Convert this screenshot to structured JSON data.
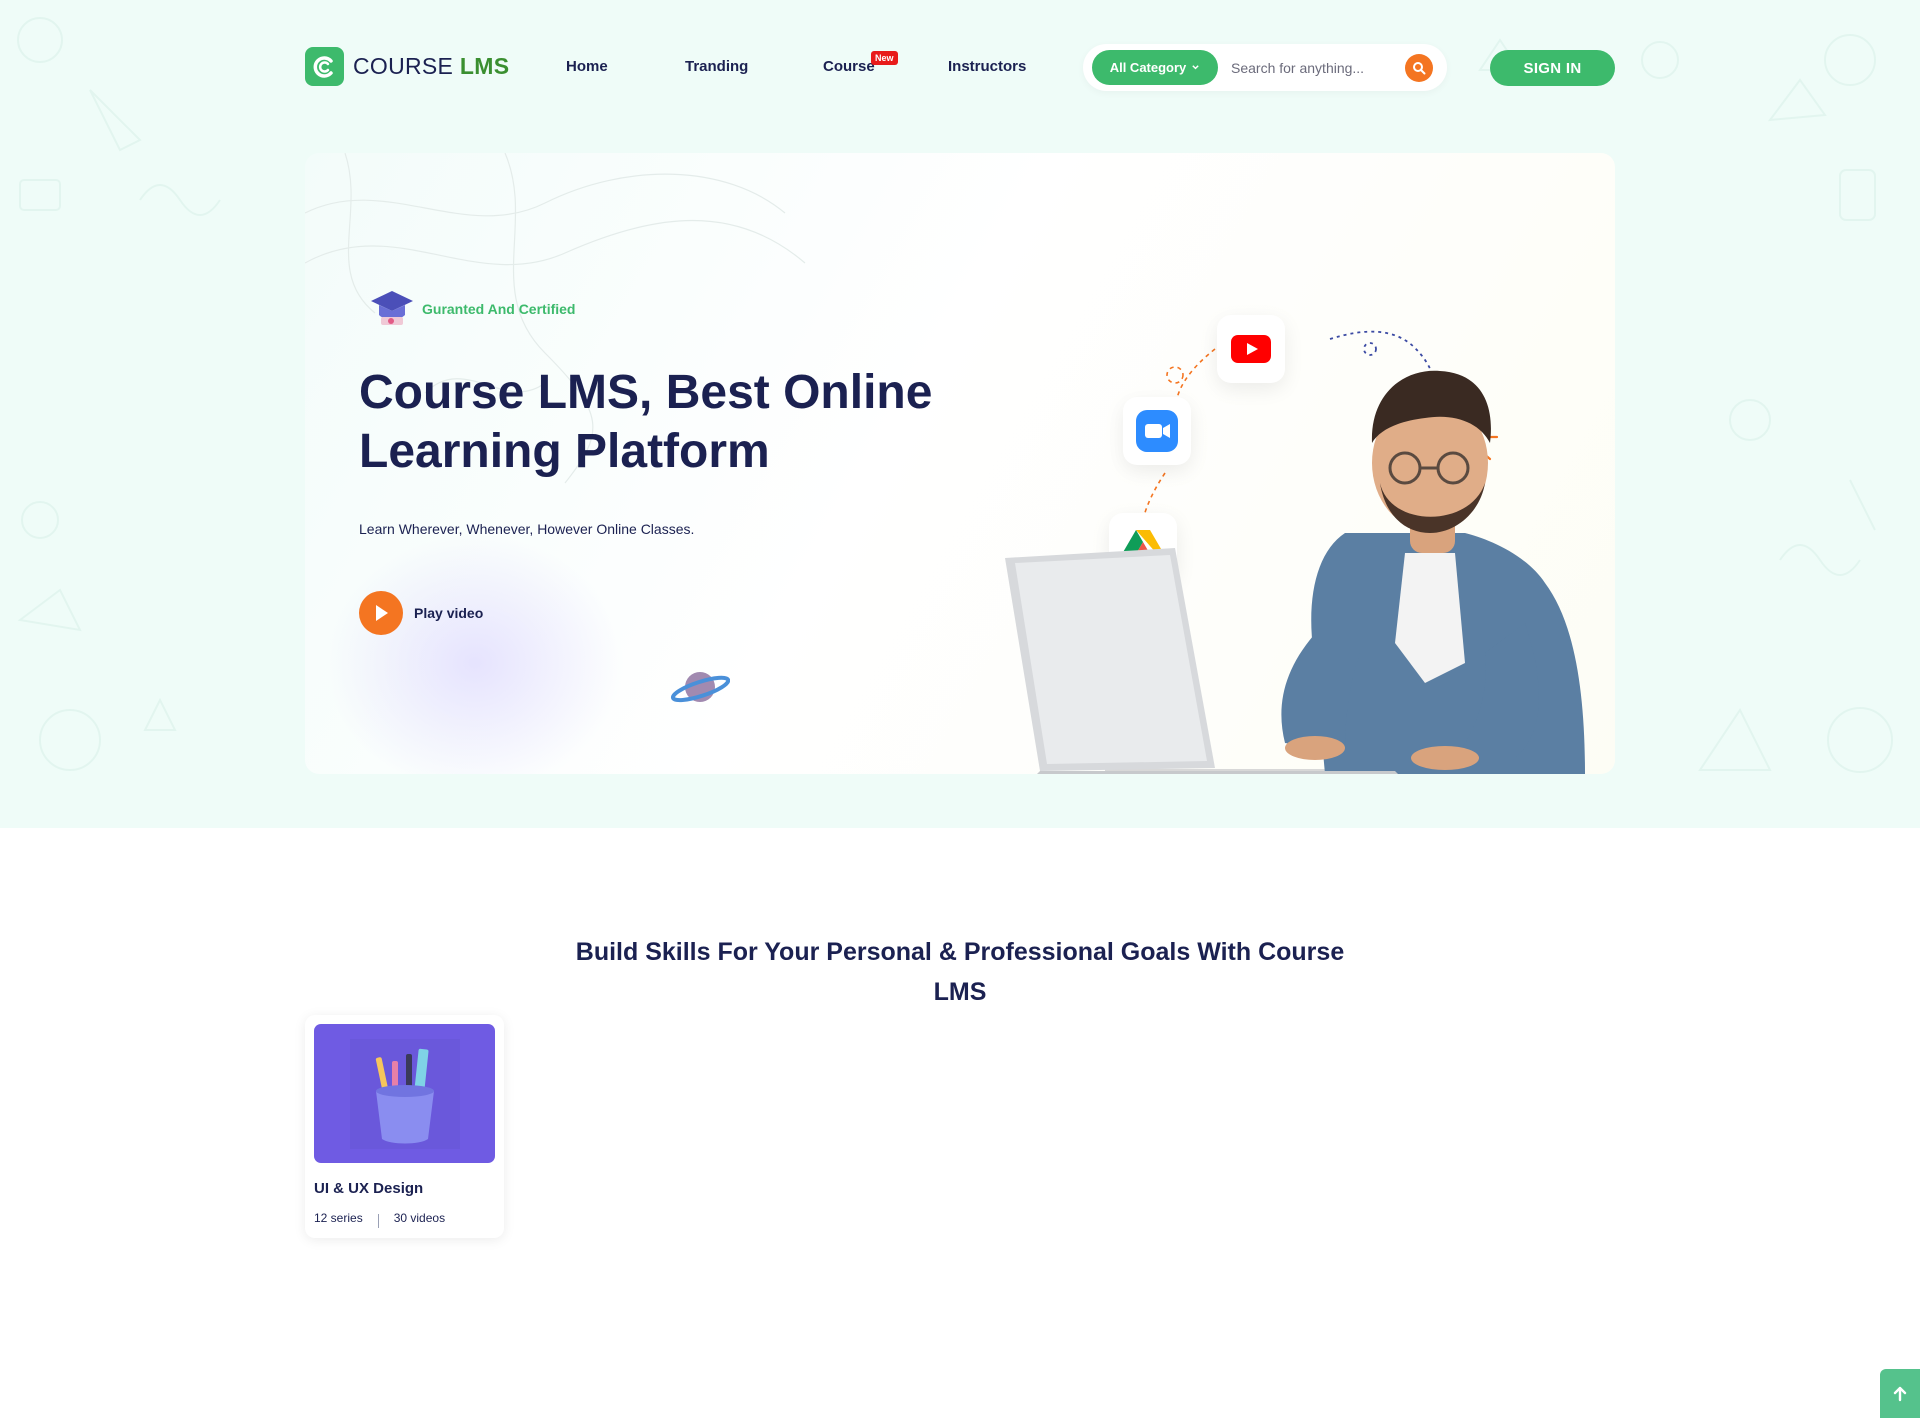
{
  "header": {
    "logo": {
      "text_first": "COURSE",
      "text_second": "LMS",
      "icon": "logo-c-icon"
    },
    "nav": [
      {
        "label": "Home"
      },
      {
        "label": "Tranding"
      },
      {
        "label": "Course",
        "badge": "New"
      },
      {
        "label": "Instructors"
      }
    ],
    "search": {
      "category_label": "All Category",
      "placeholder": "Search for anything...",
      "icon": "search-icon"
    },
    "signin_label": "SIGN IN"
  },
  "hero": {
    "tagline": "Guranted And Certified",
    "title": "Course LMS, Best Online Learning Platform",
    "subtitle": "Learn Wherever, Whenever, However Online Classes.",
    "play_label": "Play video",
    "app_icons": [
      "youtube-icon",
      "zoom-icon",
      "google-drive-icon"
    ]
  },
  "skills": {
    "title": "Build Skills For Your Personal & Professional Goals With Course LMS",
    "cards": [
      {
        "title": "UI & UX Design",
        "series": "12 series",
        "videos": "30 videos",
        "image": "pencil-cup-icon"
      }
    ]
  },
  "colors": {
    "brand_green": "#3dba6c",
    "accent_orange": "#f47521",
    "navy_text": "#1b2151",
    "top_background": "#effcf8",
    "card_thumb": "#6f5be3",
    "badge_red": "#e81b1b"
  }
}
